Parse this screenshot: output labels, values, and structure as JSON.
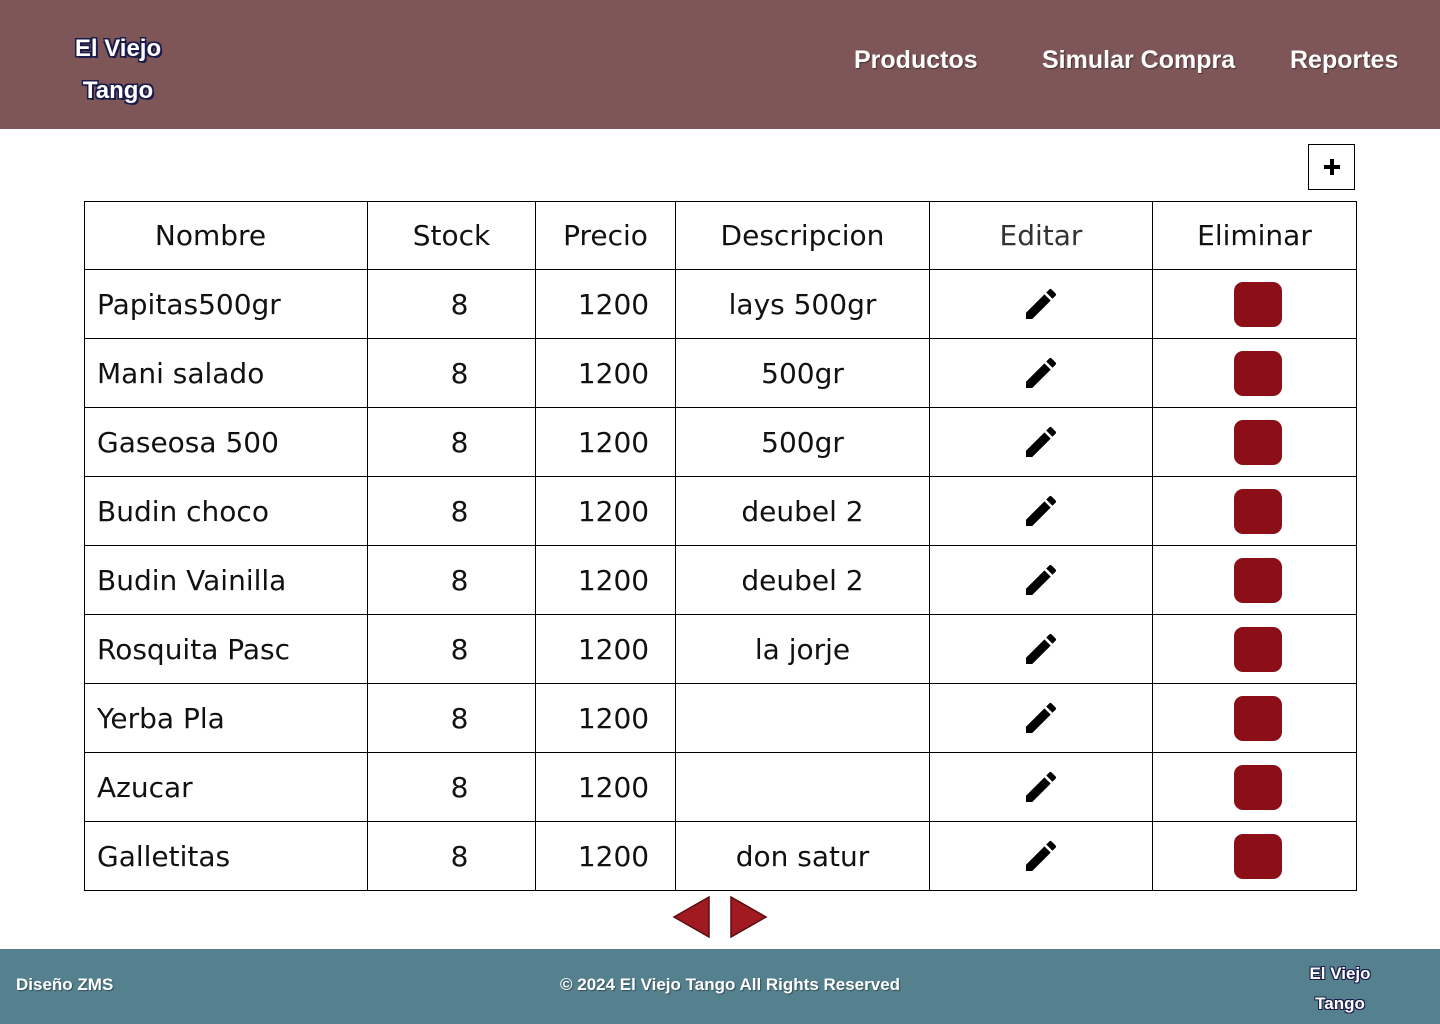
{
  "header": {
    "logo_line1": "El Viejo",
    "logo_line2": "Tango",
    "nav": {
      "productos": "Productos",
      "simular_compra": "Simular Compra",
      "reportes": "Reportes"
    }
  },
  "toolbar": {
    "add_label": "+"
  },
  "table": {
    "headers": [
      "Nombre",
      "Stock",
      "Precio",
      "Descripcion",
      "Editar",
      "Eliminar"
    ],
    "rows": [
      {
        "nombre": "Papitas500gr",
        "stock": "8",
        "precio": "1200",
        "descripcion": "lays 500gr"
      },
      {
        "nombre": "Mani salado",
        "stock": "8",
        "precio": "1200",
        "descripcion": "500gr"
      },
      {
        "nombre": "Gaseosa 500",
        "stock": "8",
        "precio": "1200",
        "descripcion": "500gr"
      },
      {
        "nombre": "Budin choco",
        "stock": "8",
        "precio": "1200",
        "descripcion": "deubel 2"
      },
      {
        "nombre": "Budin Vainilla",
        "stock": "8",
        "precio": "1200",
        "descripcion": "deubel 2"
      },
      {
        "nombre": "Rosquita Pasc",
        "stock": "8",
        "precio": "1200",
        "descripcion": "la jorje"
      },
      {
        "nombre": "Yerba Pla",
        "stock": "8",
        "precio": "1200",
        "descripcion": ""
      },
      {
        "nombre": "Azucar",
        "stock": "8",
        "precio": "1200",
        "descripcion": ""
      },
      {
        "nombre": "Galletitas",
        "stock": "8",
        "precio": "1200",
        "descripcion": "don satur"
      }
    ]
  },
  "footer": {
    "designer": "Diseño ZMS",
    "copyright": "© 2024  El Viejo Tango All Rights Reserved",
    "logo_line1": "El Viejo",
    "logo_line2": "Tango"
  },
  "colors": {
    "header_bg": "#7f5657",
    "footer_bg": "#55818f",
    "delete_button": "#8c0f17",
    "pager_arrow": "#a11a22"
  },
  "icons": {
    "edit": "pencil-icon",
    "add": "plus-icon",
    "prev": "caret-left-icon",
    "next": "caret-right-icon"
  }
}
